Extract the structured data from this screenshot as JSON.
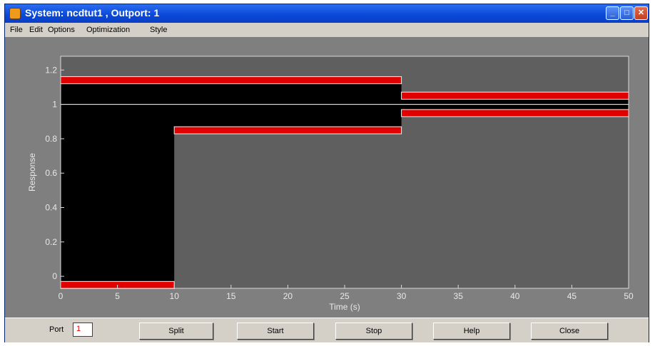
{
  "window": {
    "title": "System: ncdtut1 , Outport: 1",
    "controls": [
      "minimize-icon",
      "maximize-icon",
      "close-icon"
    ]
  },
  "menu": {
    "items": [
      "File",
      "Edit",
      "Options",
      "Optimization",
      "Style"
    ]
  },
  "plot": {
    "xlabel": "Time (s)",
    "ylabel": "Response",
    "xticks": [
      "0",
      "5",
      "10",
      "15",
      "20",
      "25",
      "30",
      "35",
      "40",
      "45",
      "50"
    ],
    "yticks": [
      "0",
      "0.2",
      "0.4",
      "0.6",
      "0.8",
      "1",
      "1.2"
    ]
  },
  "chart_data": {
    "type": "area",
    "xlim": [
      0,
      50
    ],
    "ylim": [
      -0.07,
      1.28
    ],
    "upper_bound": [
      {
        "x": [
          0,
          30
        ],
        "y": 1.12
      },
      {
        "x": [
          30,
          50
        ],
        "y": 1.03
      }
    ],
    "lower_bound": [
      {
        "x": [
          0,
          10
        ],
        "y": -0.03
      },
      {
        "x": [
          10,
          30
        ],
        "y": 0.87
      },
      {
        "x": [
          30,
          50
        ],
        "y": 0.97
      }
    ],
    "response": {
      "x": [
        0,
        50
      ],
      "y": [
        1.0,
        1.0
      ]
    },
    "colors": {
      "background": "#7f7f7f",
      "plot_area": "#5f5f5f",
      "feasible_region": "#000000",
      "constraint": "#e00000",
      "response": "#ffffff"
    }
  },
  "bottom": {
    "port_label": "Port",
    "port_value": "1",
    "buttons": [
      "Split",
      "Start",
      "Stop",
      "Help",
      "Close"
    ]
  }
}
